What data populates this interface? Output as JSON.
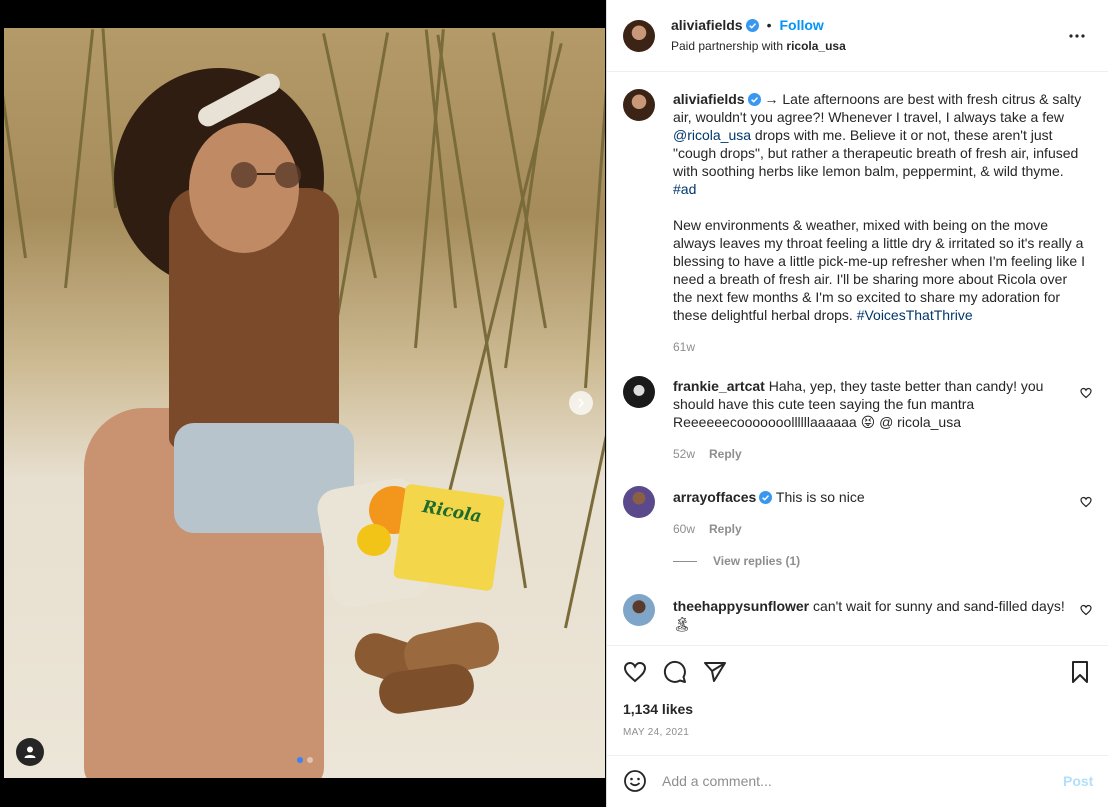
{
  "post": {
    "username": "aliviafields",
    "follow_label": "Follow",
    "separator": "•",
    "partnership_prefix": "Paid partnership with",
    "partner": "ricola_usa",
    "likes": "1,134 likes",
    "date": "MAY 24, 2021"
  },
  "caption": {
    "username": "aliviafields",
    "arrow": "→",
    "line1": "Late afternoons are best with fresh citrus & salty air, wouldn't you agree?! Whenever I travel, I always take a few",
    "mention": "@ricola_usa",
    "line2": "drops with me. Believe it or not, these aren't just \"cough drops\", but rather a therapeutic breath of fresh air, infused with soothing herbs like lemon balm, peppermint, & wild thyme.",
    "hashtag1": "#ad",
    "para2": "New environments & weather, mixed with being on the move always leaves my throat feeling a little dry & irritated so it's really a blessing to have a little pick-me-up refresher when I'm feeling like I need a breath of fresh air. I'll be sharing more about Ricola over the next few months & I'm so excited to share my adoration for these delightful herbal drops.",
    "hashtag2": "#VoicesThatThrive",
    "age": "61w"
  },
  "comments": [
    {
      "username": "frankie_artcat",
      "text": "Haha, yep, they taste better than candy! you should have this cute teen saying the fun mantra Reeeeeecooooooollllllaaaaaa 😝 @ ricola_usa",
      "age": "52w",
      "reply_label": "Reply"
    },
    {
      "username": "arrayoffaces",
      "text": "This is so nice",
      "age": "60w",
      "reply_label": "Reply",
      "view_replies": "View replies (1)"
    },
    {
      "username": "theehappysunflower",
      "text": "can't wait for sunny and sand-filled days! 🏝"
    }
  ],
  "photo": {
    "bag_brand": "Ricola"
  },
  "comment_box": {
    "placeholder": "Add a comment...",
    "post_label": "Post"
  },
  "colors": {
    "accent": "#0095f6",
    "link": "#00376b",
    "muted": "#8e8e8e"
  }
}
